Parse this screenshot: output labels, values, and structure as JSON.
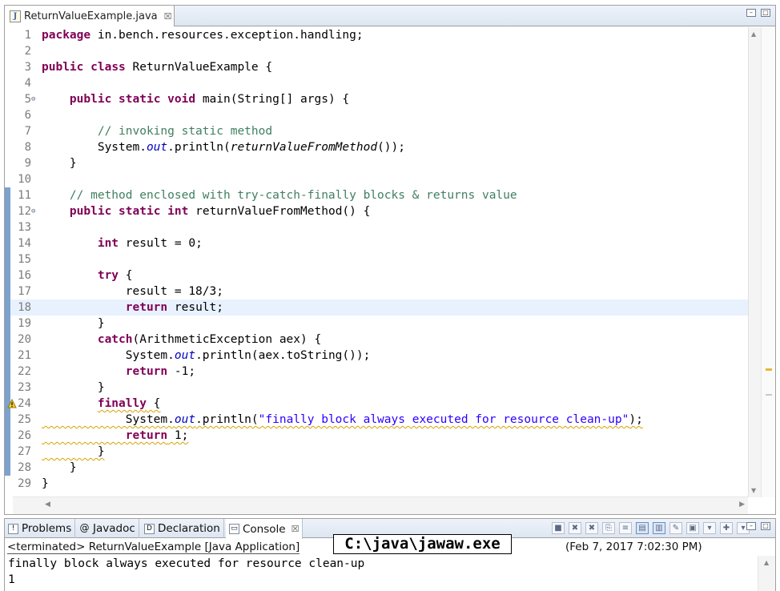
{
  "editor": {
    "tab_title": "ReturnValueExample.java",
    "tab_close_glyph": "☒",
    "lines": [
      {
        "n": "1",
        "tokens": [
          {
            "t": "package",
            "c": "kw"
          },
          {
            "t": " in.bench.resources.exception.handling;"
          }
        ]
      },
      {
        "n": "2",
        "tokens": []
      },
      {
        "n": "3",
        "tokens": [
          {
            "t": "public",
            "c": "kw"
          },
          {
            "t": " "
          },
          {
            "t": "class",
            "c": "kw"
          },
          {
            "t": " ReturnValueExample {"
          }
        ]
      },
      {
        "n": "4",
        "tokens": []
      },
      {
        "n": "5",
        "fold": true,
        "tokens": [
          {
            "t": "    "
          },
          {
            "t": "public",
            "c": "kw"
          },
          {
            "t": " "
          },
          {
            "t": "static",
            "c": "kw"
          },
          {
            "t": " "
          },
          {
            "t": "void",
            "c": "kw"
          },
          {
            "t": " main(String[] args) {"
          }
        ]
      },
      {
        "n": "6",
        "tokens": []
      },
      {
        "n": "7",
        "tokens": [
          {
            "t": "        "
          },
          {
            "t": "// invoking static method",
            "c": "cm"
          }
        ]
      },
      {
        "n": "8",
        "tokens": [
          {
            "t": "        System."
          },
          {
            "t": "out",
            "c": "fi"
          },
          {
            "t": ".println("
          },
          {
            "t": "returnValueFromMethod",
            "c": "it"
          },
          {
            "t": "());"
          }
        ]
      },
      {
        "n": "9",
        "tokens": [
          {
            "t": "    }"
          }
        ]
      },
      {
        "n": "10",
        "tokens": []
      },
      {
        "n": "11",
        "changed": true,
        "tokens": [
          {
            "t": "    "
          },
          {
            "t": "// method enclosed with try-catch-finally blocks & returns value",
            "c": "cm"
          }
        ]
      },
      {
        "n": "12",
        "changed": true,
        "fold": true,
        "tokens": [
          {
            "t": "    "
          },
          {
            "t": "public",
            "c": "kw"
          },
          {
            "t": " "
          },
          {
            "t": "static",
            "c": "kw"
          },
          {
            "t": " "
          },
          {
            "t": "int",
            "c": "kw"
          },
          {
            "t": " returnValueFromMethod() {"
          }
        ]
      },
      {
        "n": "13",
        "changed": true,
        "tokens": []
      },
      {
        "n": "14",
        "changed": true,
        "tokens": [
          {
            "t": "        "
          },
          {
            "t": "int",
            "c": "kw"
          },
          {
            "t": " result = 0;"
          }
        ]
      },
      {
        "n": "15",
        "changed": true,
        "tokens": []
      },
      {
        "n": "16",
        "changed": true,
        "tokens": [
          {
            "t": "        "
          },
          {
            "t": "try",
            "c": "kw"
          },
          {
            "t": " {"
          }
        ]
      },
      {
        "n": "17",
        "changed": true,
        "tokens": [
          {
            "t": "            result = 18/3;"
          }
        ]
      },
      {
        "n": "18",
        "changed": true,
        "current": true,
        "tokens": [
          {
            "t": "            "
          },
          {
            "t": "return",
            "c": "kw"
          },
          {
            "t": " result;"
          }
        ]
      },
      {
        "n": "19",
        "changed": true,
        "tokens": [
          {
            "t": "        }"
          }
        ]
      },
      {
        "n": "20",
        "changed": true,
        "tokens": [
          {
            "t": "        "
          },
          {
            "t": "catch",
            "c": "kw"
          },
          {
            "t": "(ArithmeticException aex) {"
          }
        ]
      },
      {
        "n": "21",
        "changed": true,
        "tokens": [
          {
            "t": "            System."
          },
          {
            "t": "out",
            "c": "fi"
          },
          {
            "t": ".println(aex.toString());"
          }
        ]
      },
      {
        "n": "22",
        "changed": true,
        "tokens": [
          {
            "t": "            "
          },
          {
            "t": "return",
            "c": "kw"
          },
          {
            "t": " -1;"
          }
        ]
      },
      {
        "n": "23",
        "changed": true,
        "tokens": [
          {
            "t": "        }"
          }
        ]
      },
      {
        "n": "24",
        "changed": true,
        "warning": true,
        "tokens": [
          {
            "t": "        "
          },
          {
            "t": "finally",
            "c": "kw squig"
          },
          {
            "t": " {",
            "c": "squig"
          }
        ]
      },
      {
        "n": "25",
        "changed": true,
        "tokens": [
          {
            "t": "            System.",
            "c": "squig"
          },
          {
            "t": "out",
            "c": "fi squig"
          },
          {
            "t": ".println(",
            "c": "squig"
          },
          {
            "t": "\"finally block always executed for resource clean-up\"",
            "c": "st squig"
          },
          {
            "t": ");",
            "c": "squig"
          }
        ]
      },
      {
        "n": "26",
        "changed": true,
        "tokens": [
          {
            "t": "            ",
            "c": "squig"
          },
          {
            "t": "return",
            "c": "kw squig"
          },
          {
            "t": " 1;",
            "c": "squig"
          }
        ]
      },
      {
        "n": "27",
        "changed": true,
        "tokens": [
          {
            "t": "        }",
            "c": "squig"
          }
        ]
      },
      {
        "n": "28",
        "changed": true,
        "tokens": [
          {
            "t": "    }"
          }
        ]
      },
      {
        "n": "29",
        "tokens": [
          {
            "t": "}"
          }
        ]
      }
    ]
  },
  "console": {
    "tabs": [
      {
        "label": "Problems",
        "icon": "problems-icon",
        "glyph": "!"
      },
      {
        "label": "Javadoc",
        "icon": "at-sign-icon",
        "glyph": "@"
      },
      {
        "label": "Declaration",
        "icon": "declaration-icon",
        "glyph": "D"
      },
      {
        "label": "Console",
        "icon": "console-icon",
        "glyph": "▭",
        "active": true,
        "close": "☒"
      }
    ],
    "status": "<terminated> ReturnValueExample [Java Application]",
    "timestamp": "(Feb 7, 2017 7:02:30 PM)",
    "output": "finally block always executed for resource clean-up\n1",
    "toolbar": [
      {
        "name": "terminate-button",
        "glyph": "■"
      },
      {
        "name": "remove-launch-button",
        "glyph": "✖"
      },
      {
        "name": "remove-all-terminated-button",
        "glyph": "✖"
      },
      {
        "name": "clear-console-button",
        "glyph": "⎘"
      },
      {
        "name": "scroll-lock-button",
        "glyph": "≡"
      },
      {
        "name": "show-stdout-button",
        "glyph": "▤",
        "on": true
      },
      {
        "name": "show-stderr-button",
        "glyph": "▥",
        "on": true
      },
      {
        "name": "pin-console-button",
        "glyph": "✎"
      },
      {
        "name": "display-console-button",
        "glyph": "▣"
      },
      {
        "name": "display-dropdown-button",
        "glyph": "▾"
      },
      {
        "name": "open-console-button",
        "glyph": "✚"
      },
      {
        "name": "open-console-dropdown-button",
        "glyph": "▾"
      }
    ]
  },
  "overlay": {
    "path_label": "C:\\java\\jawaw.exe"
  },
  "colors": {
    "keyword": "#7f0055",
    "comment": "#3f7f5f",
    "string": "#2a00ff",
    "static_field": "#0000c0",
    "current_line": "#e8f2fe",
    "change_bar": "#7da2ce",
    "warning_underline": "#d4a400"
  }
}
